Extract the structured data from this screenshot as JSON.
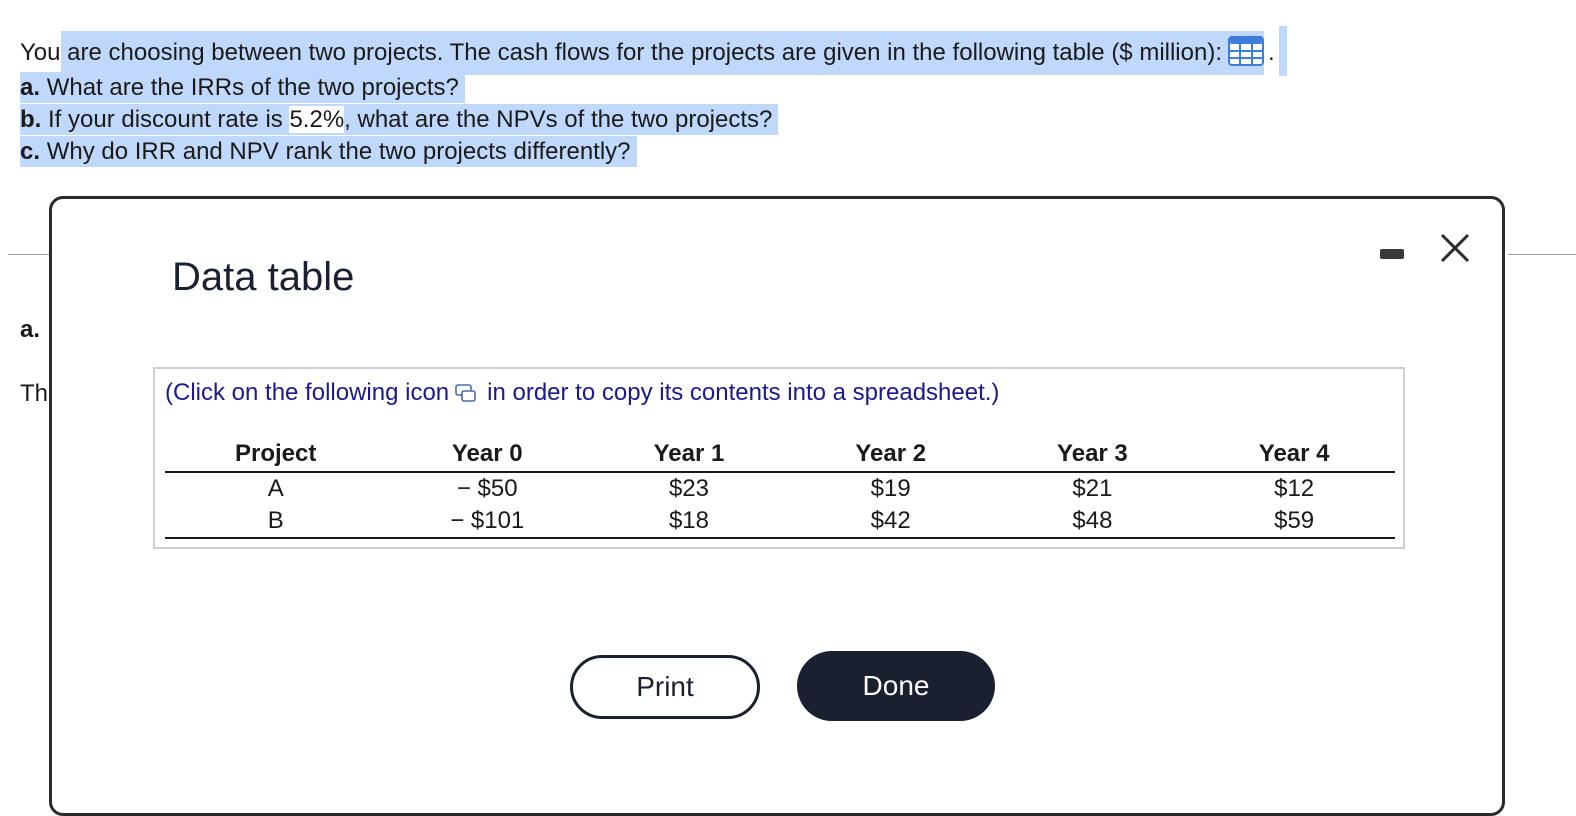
{
  "question": {
    "intro_lead": "You",
    "intro_rest": "are choosing between two projects. The cash flows for the projects are given in the following table ($ million):",
    "intro_period": ".",
    "part_a_label": "a.",
    "part_a_text": "What are the IRRs of the two projects?",
    "part_b_label": "b.",
    "part_b_text_pre": "If your discount rate is",
    "part_b_rate": "5.2%",
    "part_b_text_post": ", what are the NPVs of the two projects?",
    "part_c_label": "c.",
    "part_c_text": "Why do IRR and NPV rank the two projects differently?"
  },
  "background": {
    "part_a": "a.",
    "partial_text": "Th"
  },
  "dialog": {
    "title": "Data table",
    "hint_pre": "(Click on the following icon",
    "hint_post": "in order to copy its contents into a spreadsheet.)",
    "table": {
      "headers": [
        "Project",
        "Year 0",
        "Year 1",
        "Year 2",
        "Year 3",
        "Year 4"
      ],
      "rows": [
        [
          "A",
          "− $50",
          "$23",
          "$19",
          "$21",
          "$12"
        ],
        [
          "B",
          "− $101",
          "$18",
          "$42",
          "$48",
          "$59"
        ]
      ]
    },
    "print_label": "Print",
    "done_label": "Done"
  },
  "colors": {
    "highlight": "#bfd8fb",
    "dark_button": "#1b2030",
    "hint_text": "#1a1a8c",
    "grid_icon": "#3d7ddb"
  },
  "icons": [
    "grid-table-icon",
    "copy-icon",
    "minimize-icon",
    "close-icon"
  ]
}
